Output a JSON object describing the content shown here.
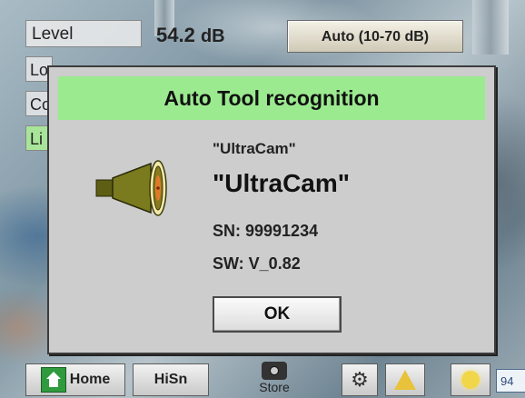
{
  "header": {
    "level_label": "Level",
    "level_value": "54.2",
    "level_unit": "dB",
    "range_label": "Auto (10-70 dB)"
  },
  "side_stubs": [
    "Lo",
    "Co",
    "Li"
  ],
  "dialog": {
    "title": "Auto Tool recognition",
    "tool_name_small": "\"UltraCam\"",
    "tool_name_large": "\"UltraCam\"",
    "serial": "SN: 99991234",
    "software": "SW: V_0.82",
    "ok_label": "OK"
  },
  "toolbar": {
    "home_label": "Home",
    "hisn_label": "HiSn",
    "store_label": "Store",
    "counter_label": "94"
  },
  "icons": {
    "tool": "ultrasonic-sensor-icon",
    "home": "home-icon",
    "store": "camera-icon",
    "settings": "gear-icon",
    "warning": "warning-icon",
    "light": "light-icon"
  },
  "colors": {
    "dialog_title_bg": "#9bea8f",
    "dialog_bg": "#cdcdcd",
    "tool_body": "#7a7a1e",
    "tool_accent": "#e07a2a"
  }
}
